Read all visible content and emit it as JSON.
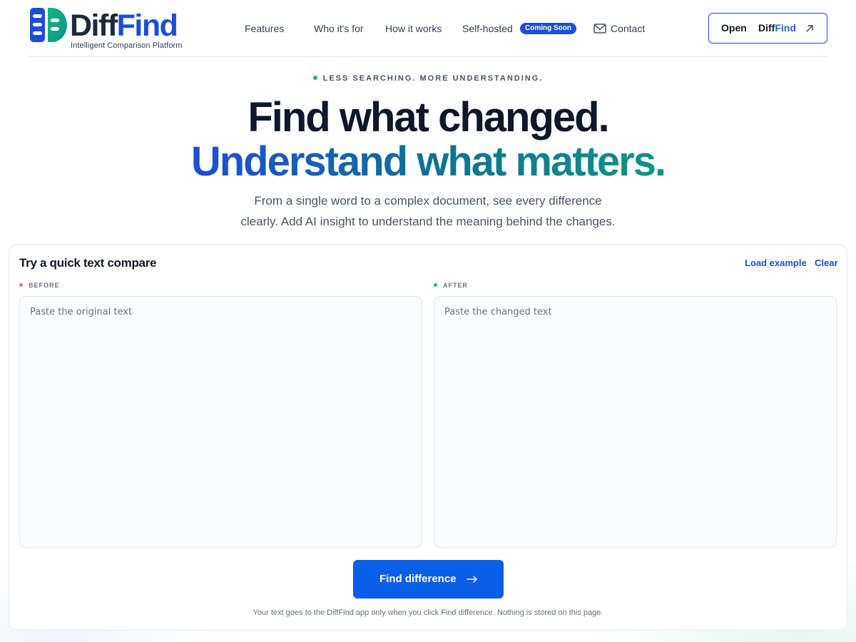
{
  "header": {
    "logo": {
      "word_diff": "Diff",
      "word_find": "Find",
      "tagline": "Intelligent Comparison Platform"
    },
    "nav": {
      "features": "Features",
      "who": "Who it's for",
      "how": "How it works",
      "self_hosted": "Self-hosted",
      "self_hosted_badge": "Coming Soon",
      "contact": "Contact"
    },
    "open_button": {
      "open": "Open",
      "diff": "Diff",
      "find": "Find"
    }
  },
  "hero": {
    "eyebrow": "LESS SEARCHING. MORE UNDERSTANDING.",
    "headline_1": "Find what changed.",
    "headline_2": "Understand what matters.",
    "sub_1": "From a single word to a complex document, see every difference",
    "sub_2": "clearly. Add AI insight to understand the meaning behind the changes."
  },
  "compare": {
    "title": "Try a quick text compare",
    "load_example": "Load example",
    "clear": "Clear",
    "before": {
      "label": "BEFORE",
      "placeholder": "Paste the original text",
      "value": ""
    },
    "after": {
      "label": "AFTER",
      "placeholder": "Paste the changed text",
      "value": ""
    },
    "button": "Find difference",
    "note": "Your text goes to the DiffFind app only when you click Find difference. Nothing is stored on this page."
  },
  "colors": {
    "brand_blue": "#1d4ed8",
    "primary_button": "#0b5ee8",
    "accent_green": "#10b981",
    "before_dot": "#e5738a",
    "after_dot": "#10b981"
  },
  "icons": {
    "mail": "mail-icon",
    "external": "arrow-up-right-icon",
    "button_arrow": "arrow-right-icon"
  }
}
